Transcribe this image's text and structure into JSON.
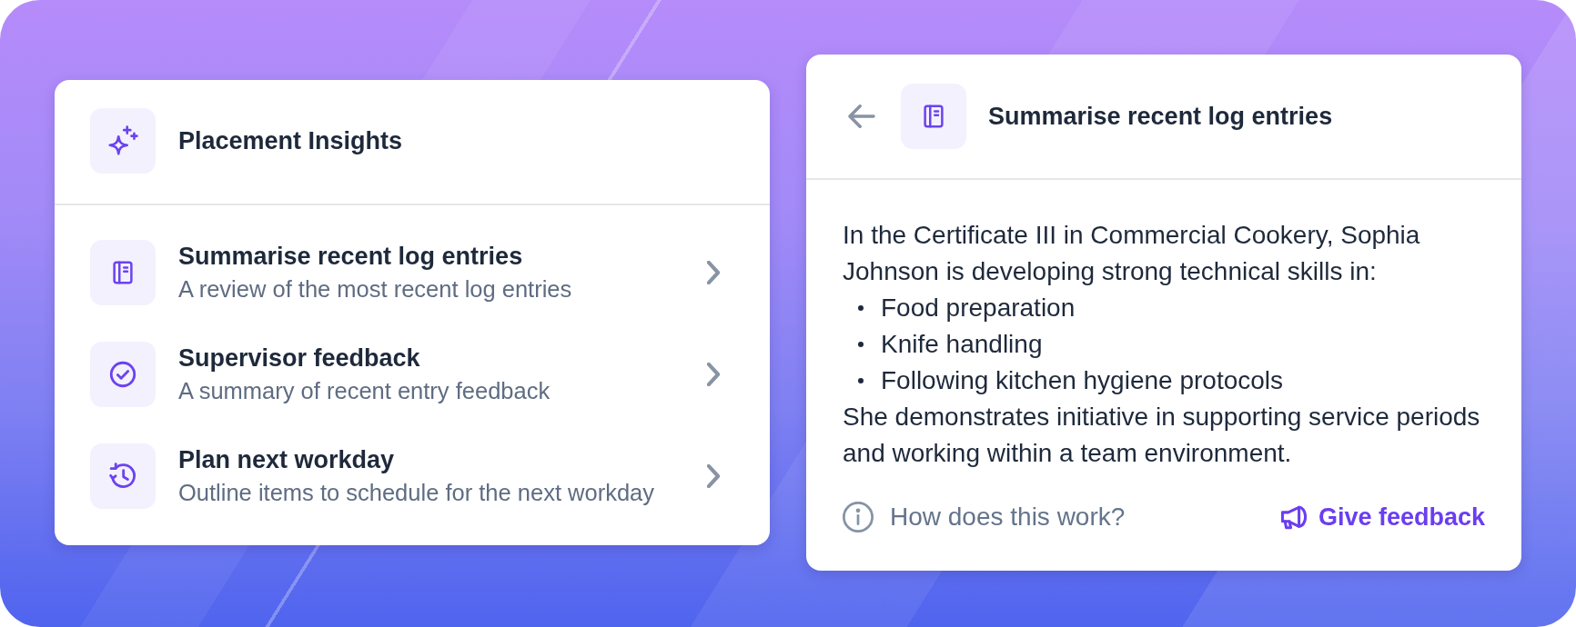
{
  "insights_panel": {
    "title": "Placement Insights",
    "options": [
      {
        "title": "Summarise recent log entries",
        "description": "A review of the most recent log entries"
      },
      {
        "title": "Supervisor feedback",
        "description": "A summary of recent entry feedback"
      },
      {
        "title": "Plan next workday",
        "description": "Outline items to schedule for the next workday"
      }
    ]
  },
  "detail_panel": {
    "title": "Summarise recent log entries",
    "summary": {
      "intro": "In the Certificate III in Commercial Cookery, Sophia Johnson is developing strong technical skills in:",
      "bullets": [
        "Food preparation",
        "Knife handling",
        "Following kitchen hygiene protocols"
      ],
      "closing": "She demonstrates initiative in supporting service periods and working within a team environment."
    },
    "footer": {
      "help_link": "How does this work?",
      "feedback_button": "Give feedback"
    }
  }
}
